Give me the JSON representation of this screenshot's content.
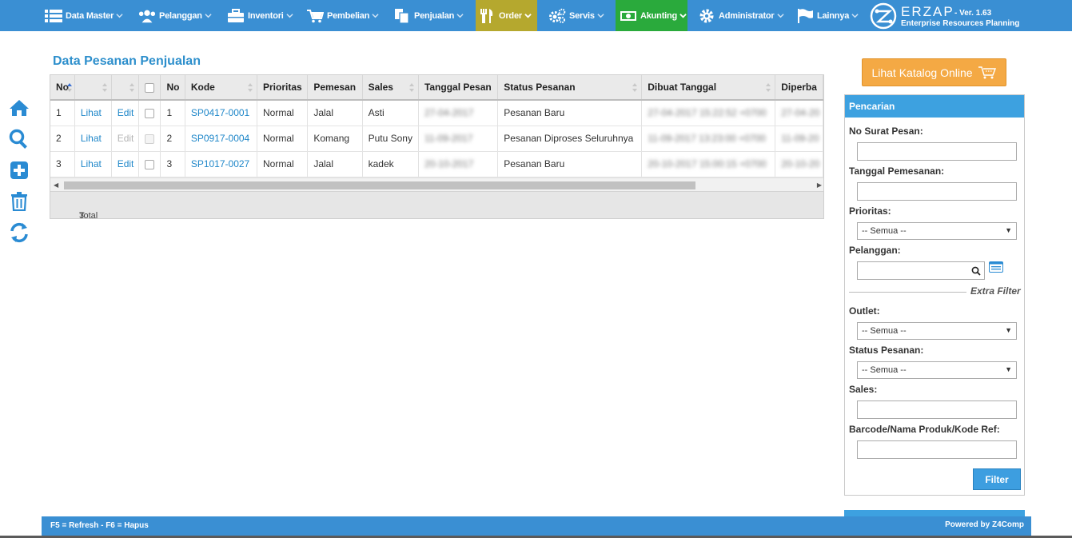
{
  "nav": {
    "items": [
      {
        "label": "Data Master",
        "icon": "list-icon"
      },
      {
        "label": "Pelanggan",
        "icon": "users-icon"
      },
      {
        "label": "Inventori",
        "icon": "briefcase-icon"
      },
      {
        "label": "Pembelian",
        "icon": "cart-icon"
      },
      {
        "label": "Penjualan",
        "icon": "copy-icon"
      },
      {
        "label": "Order",
        "icon": "cutlery-icon"
      },
      {
        "label": "Servis",
        "icon": "cogs-icon"
      },
      {
        "label": "Akunting",
        "icon": "money-icon"
      },
      {
        "label": "Administrator",
        "icon": "gear-icon"
      },
      {
        "label": "Lainnya",
        "icon": "flag-icon"
      }
    ],
    "brand": {
      "name": "ERZAP",
      "version": "- Ver. 1.63",
      "subtitle": "Enterprise Resources Planning"
    },
    "colors": {
      "bar": "#3a8fd3",
      "order": "#b5a82e",
      "akunting": "#2aaa3c"
    }
  },
  "sidebar": {
    "icons": [
      "home-icon",
      "search-icon",
      "plus-square-icon",
      "trash-icon",
      "refresh-icon"
    ]
  },
  "main": {
    "title": "Data Pesanan Penjualan",
    "columns": [
      "No",
      "",
      "",
      "",
      "No",
      "Kode",
      "Prioritas",
      "Pemesan",
      "Sales",
      "Tanggal Pesan",
      "Status Pesanan",
      "Dibuat Tanggal",
      "Diperba"
    ],
    "rows": [
      {
        "no": "1",
        "view": "Lihat",
        "edit": "Edit",
        "edit_enabled": true,
        "no2": "1",
        "kode": "SP0417-0001",
        "prioritas": "Normal",
        "pemesan": "Jalal",
        "sales": "Asti",
        "tanggal": "27-04-2017",
        "status": "Pesanan Baru",
        "dibuat": "27-04-2017 15:22:52 +0700",
        "diperbarui": "27-04-20"
      },
      {
        "no": "2",
        "view": "Lihat",
        "edit": "Edit",
        "edit_enabled": false,
        "no2": "2",
        "kode": "SP0917-0004",
        "prioritas": "Normal",
        "pemesan": "Komang",
        "sales": "Putu Sony",
        "tanggal": "11-09-2017",
        "status": "Pesanan Diproses Seluruhnya",
        "dibuat": "11-09-2017 13:23:00 +0700",
        "diperbarui": "11-09-20"
      },
      {
        "no": "3",
        "view": "Lihat",
        "edit": "Edit",
        "edit_enabled": true,
        "no2": "3",
        "kode": "SP1017-0027",
        "prioritas": "Normal",
        "pemesan": "Jalal",
        "sales": "kadek",
        "tanggal": "20-10-2017",
        "status": "Pesanan Baru",
        "dibuat": "20-10-2017 15:00:15 +0700",
        "diperbarui": "20-10-20"
      }
    ],
    "total_label": "Total data =",
    "total_value": "3"
  },
  "catalog": {
    "label": "Lihat Katalog Online"
  },
  "search": {
    "title": "Pencarian",
    "no_surat_label": "No Surat Pesan:",
    "tanggal_label": "Tanggal Pemesanan:",
    "prioritas_label": "Prioritas:",
    "prioritas_value": "-- Semua --",
    "pelanggan_label": "Pelanggan:",
    "extra_filter": "Extra Filter",
    "outlet_label": "Outlet:",
    "outlet_value": "-- Semua --",
    "status_label": "Status Pesanan:",
    "status_value": "-- Semua --",
    "sales_label": "Sales:",
    "barcode_label": "Barcode/Nama Produk/Kode Ref:",
    "filter_button": "Filter"
  },
  "footer": {
    "shortcuts": "F5 = Refresh - F6 = Hapus",
    "powered": "Powered by Z4Comp"
  }
}
